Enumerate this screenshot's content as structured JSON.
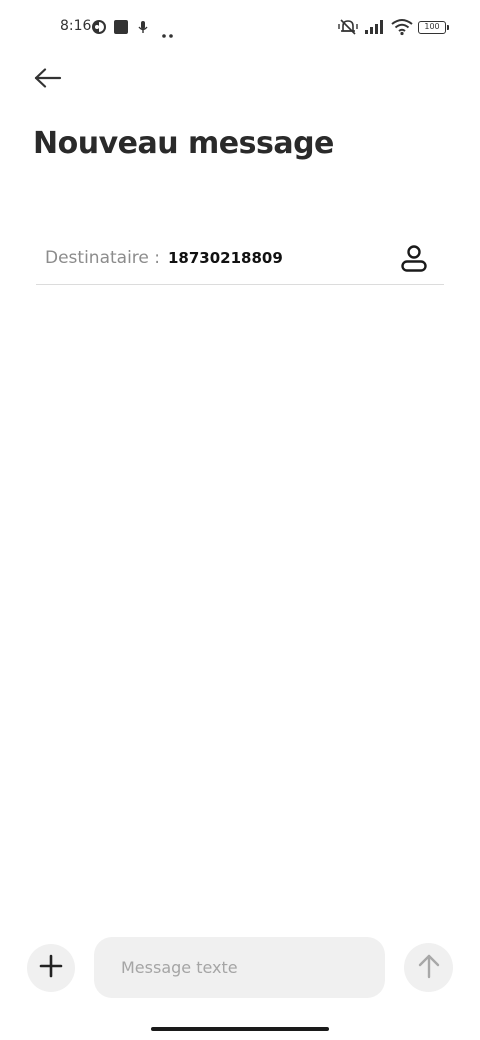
{
  "status_bar": {
    "time": "8:16",
    "battery": "100",
    "icons": [
      "app-notification-icon",
      "square-notification-icon",
      "microphone-icon",
      "more-dots-icon",
      "mute-vibrate-icon",
      "signal-icon",
      "wifi-icon",
      "battery-icon"
    ]
  },
  "header": {
    "back_icon": "arrow-left-icon",
    "title": "Nouveau message"
  },
  "recipient": {
    "label": "Destinataire :",
    "value": "18730218809",
    "contact_icon": "person-icon"
  },
  "composer": {
    "add_icon": "plus-icon",
    "placeholder": "Message texte",
    "value": "",
    "send_icon": "arrow-up-icon"
  },
  "colors": {
    "background": "#ffffff",
    "pill": "#f0f0f0",
    "placeholder": "#a5a5a5",
    "label": "#8c8c8c"
  }
}
